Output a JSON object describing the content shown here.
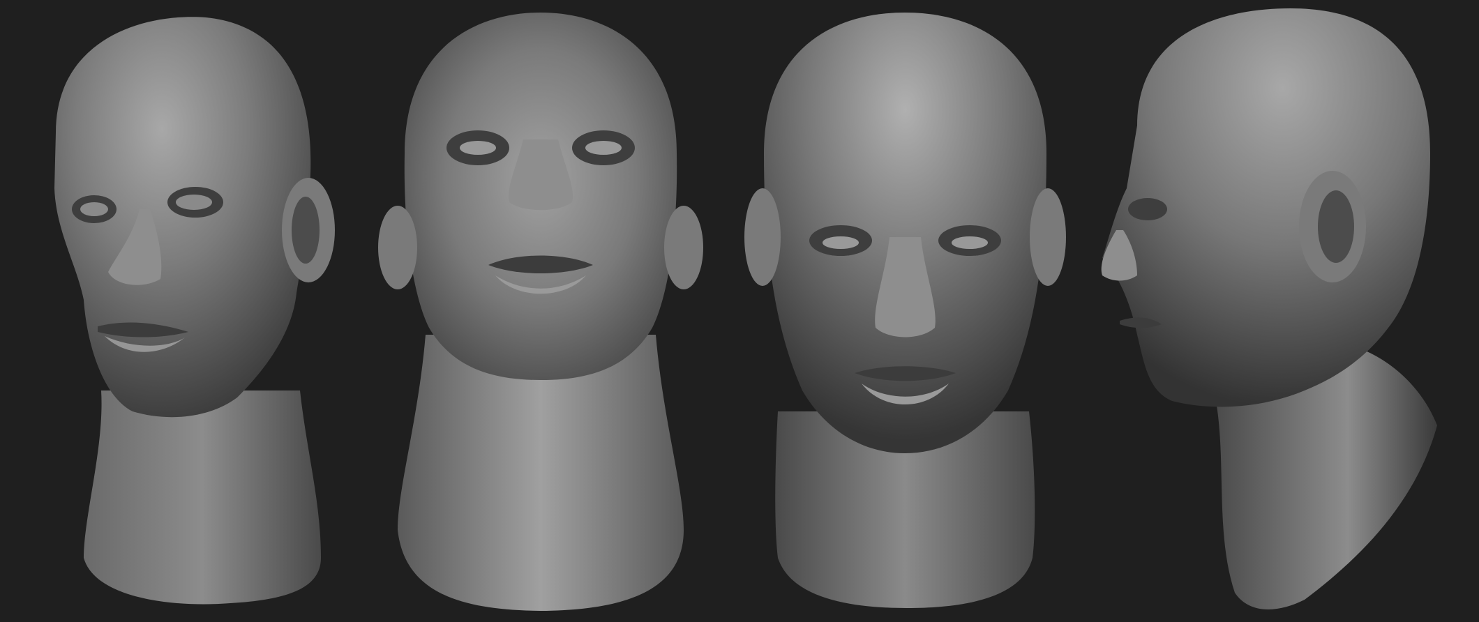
{
  "scene": {
    "background_color": "#1f1f1f",
    "material_color": "#7a7a7a",
    "views": [
      {
        "id": "three-quarter-left",
        "icon": "head-sculpt-three-quarter"
      },
      {
        "id": "low-angle-front",
        "icon": "head-sculpt-low-angle"
      },
      {
        "id": "front",
        "icon": "head-sculpt-front"
      },
      {
        "id": "profile-left",
        "icon": "head-sculpt-profile"
      }
    ]
  }
}
